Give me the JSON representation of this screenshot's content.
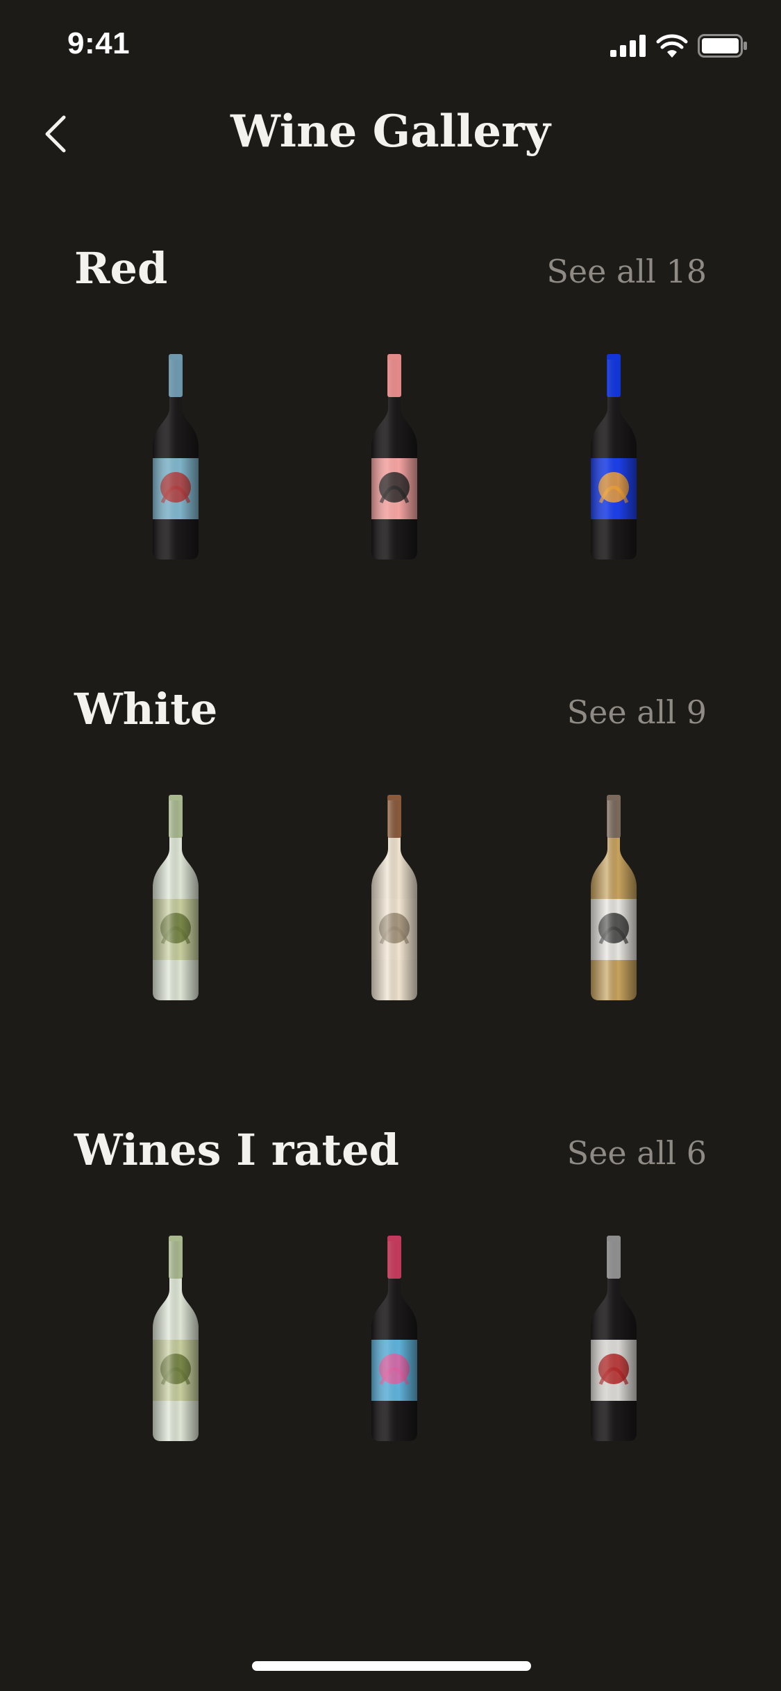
{
  "status_bar": {
    "time": "9:41"
  },
  "nav": {
    "title": "Wine Gallery",
    "back_icon": "chevron-left-icon"
  },
  "sections": [
    {
      "title": "Red",
      "see_all": "See all 18",
      "bottles": [
        {
          "name": "red-bottle-1",
          "capsule": "#6e98ad",
          "glass": "#1a1819",
          "label": "#7fb3c9",
          "art": "#b23a3a"
        },
        {
          "name": "red-bottle-2",
          "capsule": "#e58a8a",
          "glass": "#1a1819",
          "label": "#f2a3a0",
          "art": "#2a2a2a"
        },
        {
          "name": "red-bottle-3",
          "capsule": "#1235d8",
          "glass": "#1a1819",
          "label": "#1c3fe6",
          "art": "#f0a030"
        }
      ]
    },
    {
      "title": "White",
      "see_all": "See all 9",
      "bottles": [
        {
          "name": "white-bottle-1",
          "capsule": "#a9b98e",
          "glass": "#dfe6d6",
          "label": "#c8cf9e",
          "art": "#6b7a3a"
        },
        {
          "name": "white-bottle-2",
          "capsule": "#8a5a3c",
          "glass": "#efe3cf",
          "label": "#f3e6d2",
          "art": "#9a8a72"
        },
        {
          "name": "white-bottle-3",
          "capsule": "#7b6a5c",
          "glass": "#c7a25e",
          "label": "#e8e6e1",
          "art": "#3a3a3a"
        }
      ]
    },
    {
      "title": "Wines I rated",
      "see_all": "See all 6",
      "bottles": [
        {
          "name": "rated-bottle-1",
          "capsule": "#a9b98e",
          "glass": "#dfe6d6",
          "label": "#c8cf9e",
          "art": "#6b7a3a"
        },
        {
          "name": "rated-bottle-2",
          "capsule": "#c23a5c",
          "glass": "#1a1819",
          "label": "#5fb0d8",
          "art": "#e060a0"
        },
        {
          "name": "rated-bottle-3",
          "capsule": "#8e8e8e",
          "glass": "#1a1819",
          "label": "#d8d6d2",
          "art": "#b02424"
        }
      ]
    }
  ]
}
